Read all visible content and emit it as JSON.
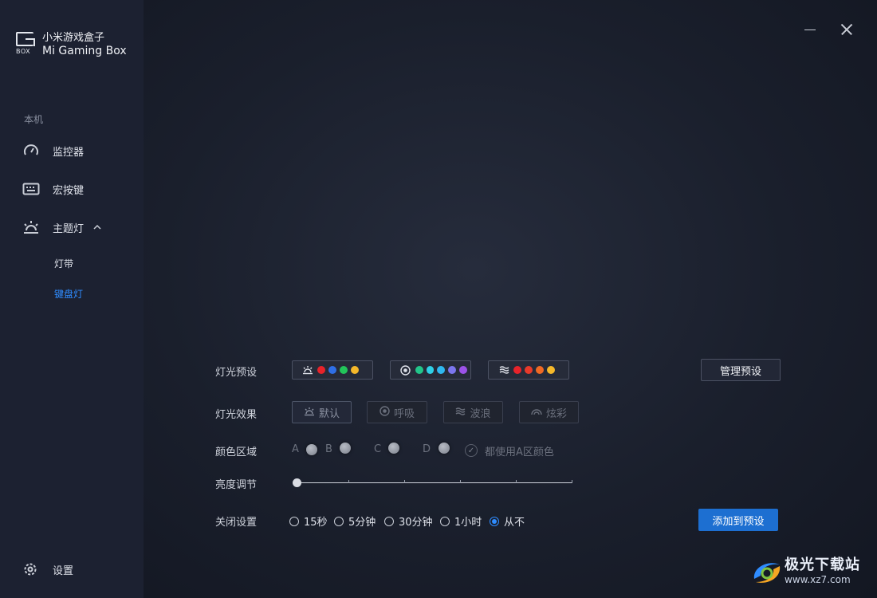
{
  "app": {
    "title_cn": "小米游戏盒子",
    "title_en": "Mi Gaming Box",
    "logo_box_text": "BOX"
  },
  "sidebar": {
    "section_label": "本机",
    "items": [
      {
        "label": "监控器",
        "icon": "gauge-icon"
      },
      {
        "label": "宏按键",
        "icon": "keyboard-icon"
      },
      {
        "label": "主题灯",
        "icon": "light-icon",
        "expanded": true
      }
    ],
    "sub_items": [
      {
        "label": "灯带",
        "active": false
      },
      {
        "label": "键盘灯",
        "active": true
      }
    ],
    "settings_label": "设置"
  },
  "lighting": {
    "preset_label": "灯光预设",
    "presets": [
      {
        "icon": "light-icon",
        "colors": [
          "#e8232a",
          "#2f6fe6",
          "#22c55a",
          "#f5b82a"
        ]
      },
      {
        "icon": "breath-icon",
        "colors": [
          "#22c58a",
          "#2fd0e6",
          "#2fb8f0",
          "#7b76ee",
          "#9b52e8"
        ]
      },
      {
        "icon": "wave-icon",
        "colors": [
          "#e8232a",
          "#e83a2a",
          "#f06a24",
          "#f5b82a"
        ]
      }
    ],
    "manage_button": "管理预设",
    "effect_label": "灯光效果",
    "effects": [
      {
        "label": "默认",
        "icon": "light-icon",
        "active": true
      },
      {
        "label": "呼吸",
        "icon": "breath-icon",
        "active": false
      },
      {
        "label": "波浪",
        "icon": "wave-icon",
        "active": false
      },
      {
        "label": "炫彩",
        "icon": "rainbow-icon",
        "active": false
      }
    ],
    "zone_label": "颜色区域",
    "zones": [
      "A",
      "B",
      "C",
      "D"
    ],
    "zone_all_label": "都使用A区颜色",
    "brightness_label": "亮度调节",
    "brightness_value": 0,
    "off_label": "关闭设置",
    "off_options": [
      "15秒",
      "5分钟",
      "30分钟",
      "1小时",
      "从不"
    ],
    "off_selected": "从不",
    "add_button": "添加到预设"
  },
  "watermark": {
    "cn": "极光下载站",
    "url": "www.xz7.com"
  },
  "colors": {
    "accent": "#2f8cff",
    "add_button_bg": "#1d6fd1",
    "sidebar_bg": "#1c2131"
  }
}
